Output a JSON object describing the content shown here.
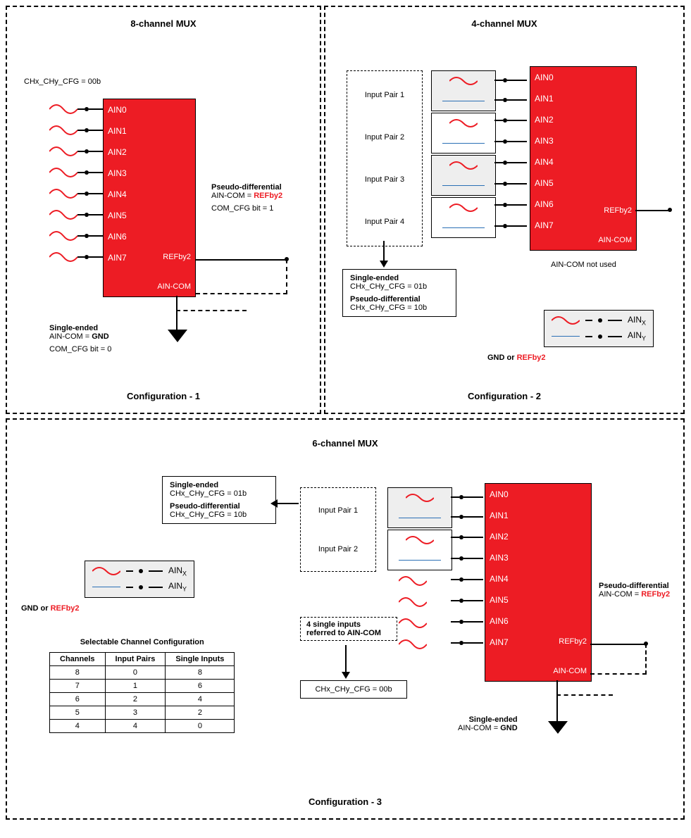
{
  "config1": {
    "title": "8-channel MUX",
    "cfg_reg": "CHx_CHy_CFG = 00b",
    "pins": [
      "AIN0",
      "AIN1",
      "AIN2",
      "AIN3",
      "AIN4",
      "AIN5",
      "AIN6",
      "AIN7"
    ],
    "refby2": "REFby2",
    "aincom": "AIN-COM",
    "pseudo_head": "Pseudo-differential",
    "pseudo_line1a": "AIN-COM = ",
    "pseudo_line1b": "REFby2",
    "pseudo_line2": "COM_CFG bit = 1",
    "se_head": "Single-ended",
    "se_line1a": "AIN-COM = ",
    "se_line1b": "GND",
    "se_line2": "COM_CFG bit = 0",
    "label": "Configuration - 1"
  },
  "config2": {
    "title": "4-channel MUX",
    "pairs": [
      "Input Pair 1",
      "Input Pair 2",
      "Input Pair 3",
      "Input Pair 4"
    ],
    "pins": [
      "AIN0",
      "AIN1",
      "AIN2",
      "AIN3",
      "AIN4",
      "AIN5",
      "AIN6",
      "AIN7"
    ],
    "refby2": "REFby2",
    "aincom": "AIN-COM",
    "aincom_note": "AIN-COM not used",
    "box_se": "Single-ended",
    "box_se_reg": "CHx_CHy_CFG = 01b",
    "box_pd": "Pseudo-differential",
    "box_pd_reg": "CHx_CHy_CFG = 10b",
    "legend_ainx": "AIN",
    "legend_x": "X",
    "legend_ainy": "AIN",
    "legend_y": "Y",
    "legend_gnd": "GND or ",
    "legend_ref": "REFby2",
    "label": "Configuration - 2"
  },
  "config3": {
    "title": "6-channel MUX",
    "box_se": "Single-ended",
    "box_se_reg": "CHx_CHy_CFG = 01b",
    "box_pd": "Pseudo-differential",
    "box_pd_reg": "CHx_CHy_CFG = 10b",
    "pair1": "Input Pair 1",
    "pair2": "Input Pair 2",
    "single_note1": "4 single inputs",
    "single_note2": "referred to AIN-COM",
    "single_reg": "CHx_CHy_CFG = 00b",
    "pins": [
      "AIN0",
      "AIN1",
      "AIN2",
      "AIN3",
      "AIN4",
      "AIN5",
      "AIN6",
      "AIN7"
    ],
    "refby2": "REFby2",
    "aincom": "AIN-COM",
    "pseudo_head": "Pseudo-differential",
    "pseudo_line1a": "AIN-COM = ",
    "pseudo_line1b": "REFby2",
    "se_head": "Single-ended",
    "se_line1a": "AIN-COM = ",
    "se_line1b": "GND",
    "legend_ainx": "AIN",
    "legend_x": "X",
    "legend_ainy": "AIN",
    "legend_y": "Y",
    "legend_gnd": "GND or ",
    "legend_ref": "REFby2",
    "table_title": "Selectable Channel Configuration",
    "table_headers": [
      "Channels",
      "Input Pairs",
      "Single Inputs"
    ],
    "table_rows": [
      [
        "8",
        "0",
        "8"
      ],
      [
        "7",
        "1",
        "6"
      ],
      [
        "6",
        "2",
        "4"
      ],
      [
        "5",
        "3",
        "2"
      ],
      [
        "4",
        "4",
        "0"
      ]
    ],
    "label": "Configuration - 3"
  }
}
